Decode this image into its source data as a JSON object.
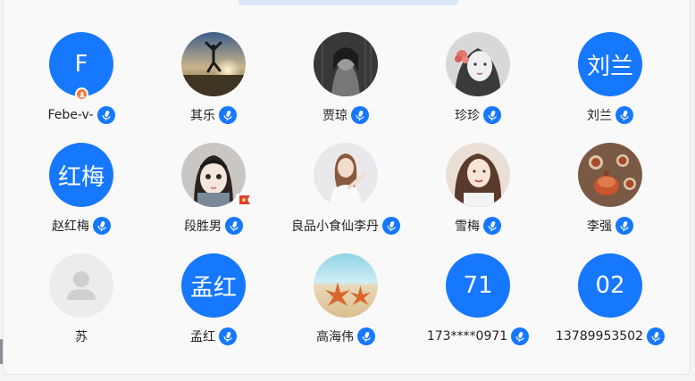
{
  "colors": {
    "accent": "#1677ff",
    "admin_badge": "#f07b3f",
    "panel_bg": "#f9f9fa",
    "default_avatar_bg": "#ececec"
  },
  "members": [
    {
      "name": "Febe-v-",
      "avatar_type": "text",
      "avatar_text": "F",
      "admin_badge": true,
      "mic": true
    },
    {
      "name": "其乐",
      "avatar_type": "photo",
      "photo": "sunset-jump",
      "mic": true
    },
    {
      "name": "贾琼",
      "avatar_type": "photo",
      "photo": "dark-portrait",
      "mic": true
    },
    {
      "name": "珍珍",
      "avatar_type": "photo",
      "photo": "girl-with-flower",
      "mic": true
    },
    {
      "name": "刘兰",
      "avatar_type": "text",
      "avatar_text": "刘兰",
      "mic": true
    },
    {
      "name": "赵红梅",
      "avatar_type": "text",
      "avatar_text": "红梅",
      "mic": true
    },
    {
      "name": "段胜男",
      "avatar_type": "photo",
      "photo": "doll-girl",
      "flag_badge": true,
      "mic": true
    },
    {
      "name": "良品小食仙李丹",
      "avatar_type": "photo",
      "photo": "woman-white-top",
      "mic": true
    },
    {
      "name": "雪梅",
      "avatar_type": "photo",
      "photo": "woman-portrait",
      "mic": true
    },
    {
      "name": "李强",
      "avatar_type": "photo",
      "photo": "tea-set",
      "mic": true
    },
    {
      "name": "苏",
      "avatar_type": "default",
      "mic": false
    },
    {
      "name": "孟红",
      "avatar_type": "text",
      "avatar_text": "孟红",
      "mic": true
    },
    {
      "name": "高海伟",
      "avatar_type": "photo",
      "photo": "starfish-beach",
      "mic": true
    },
    {
      "name": "173****0971",
      "avatar_type": "text",
      "avatar_text": "71",
      "mic": true
    },
    {
      "name": "13789953502",
      "avatar_type": "text",
      "avatar_text": "02",
      "mic": true
    }
  ]
}
